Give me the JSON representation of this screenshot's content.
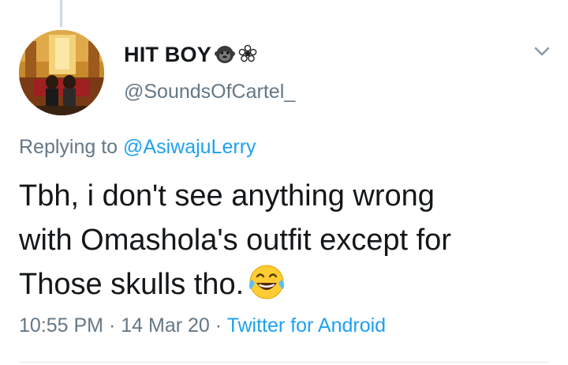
{
  "tweet": {
    "author": {
      "display_name": "HIT BOY",
      "name_emojis": [
        "gorilla-icon",
        "flower-icon"
      ],
      "handle": "@SoundsOfCartel_"
    },
    "reply": {
      "prefix": "Replying to",
      "mention": "@AsiwajuLerry"
    },
    "text_lines": [
      "Tbh, i don't see anything wrong",
      "with Omashola's outfit except for",
      "Those skulls tho."
    ],
    "text_emoji": "laughing-tears-emoji",
    "meta": {
      "time": "10:55 PM",
      "date": "14 Mar 20",
      "separator": "·",
      "source": "Twitter for Android"
    },
    "colors": {
      "link": "#1da1f2",
      "secondary": "#657786",
      "primary": "#14171a"
    }
  }
}
